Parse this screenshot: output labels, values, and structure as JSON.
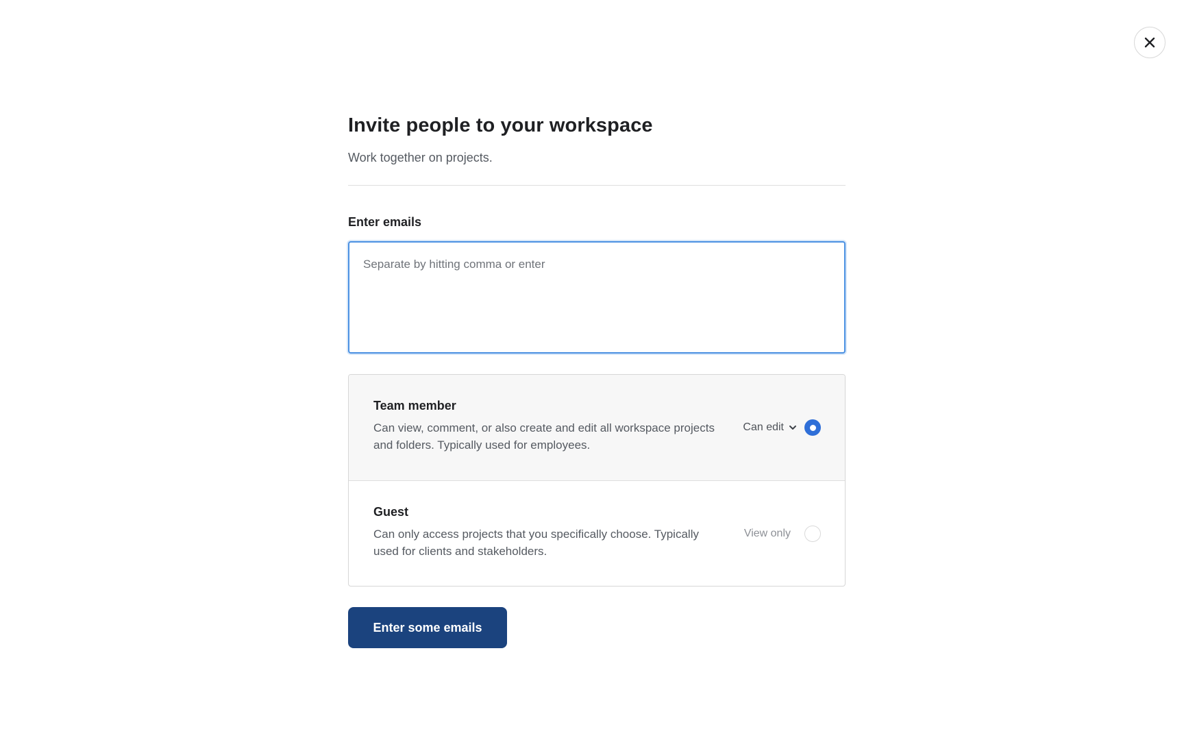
{
  "close": {
    "icon": "close-icon"
  },
  "header": {
    "title": "Invite people to your workspace",
    "subtitle": "Work together on projects."
  },
  "emails": {
    "label": "Enter emails",
    "placeholder": "Separate by hitting comma or enter",
    "value": ""
  },
  "roles": [
    {
      "title": "Team member",
      "description": "Can view, comment, or also create and edit all workspace projects and folders. Typically used for employees.",
      "permission": "Can edit",
      "permission_icon": "chevron-down-icon",
      "selected": true
    },
    {
      "title": "Guest",
      "description": "Can only access projects that you specifically choose. Typically used for clients and stakeholders.",
      "permission": "View only",
      "selected": false
    }
  ],
  "submit": {
    "label": "Enter some emails"
  },
  "colors": {
    "accent": "#2f6fd8",
    "focus_border": "#4a90e2",
    "button_bg": "#1b437e"
  }
}
